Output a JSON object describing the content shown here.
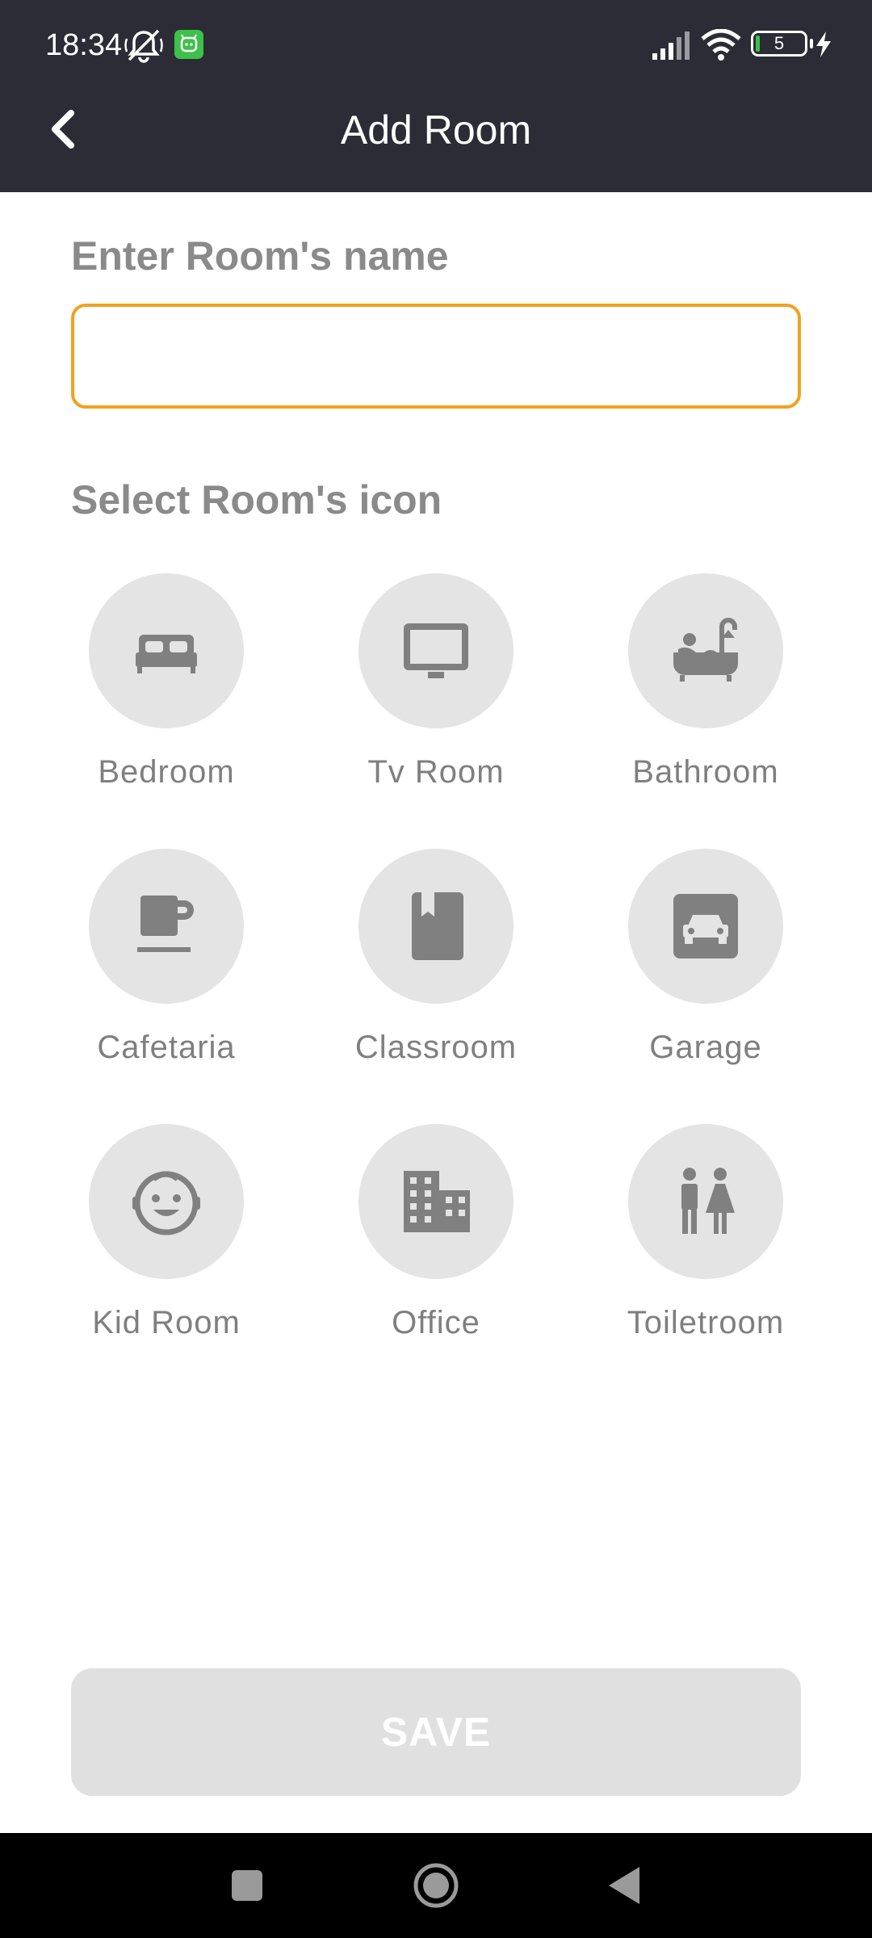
{
  "status_bar": {
    "time": "18:34",
    "battery_level": "5"
  },
  "header": {
    "title": "Add Room"
  },
  "form": {
    "name_label": "Enter Room's name",
    "name_value": "",
    "icon_label": "Select Room's icon"
  },
  "rooms": [
    {
      "label": "Bedroom",
      "icon": "bed-icon"
    },
    {
      "label": "Tv Room",
      "icon": "tv-icon"
    },
    {
      "label": "Bathroom",
      "icon": "bathtub-icon"
    },
    {
      "label": "Cafetaria",
      "icon": "coffee-cup-icon"
    },
    {
      "label": "Classroom",
      "icon": "book-icon"
    },
    {
      "label": "Garage",
      "icon": "car-icon"
    },
    {
      "label": "Kid Room",
      "icon": "child-face-icon"
    },
    {
      "label": "Office",
      "icon": "building-icon"
    },
    {
      "label": "Toiletroom",
      "icon": "wc-icon"
    }
  ],
  "actions": {
    "save_label": "SAVE"
  },
  "colors": {
    "header_bg": "#2b2c36",
    "accent": "#f0a21e",
    "icon_bg": "#e4e4e4",
    "icon_fg": "#808080",
    "disabled_button": "#e0e0e0"
  }
}
